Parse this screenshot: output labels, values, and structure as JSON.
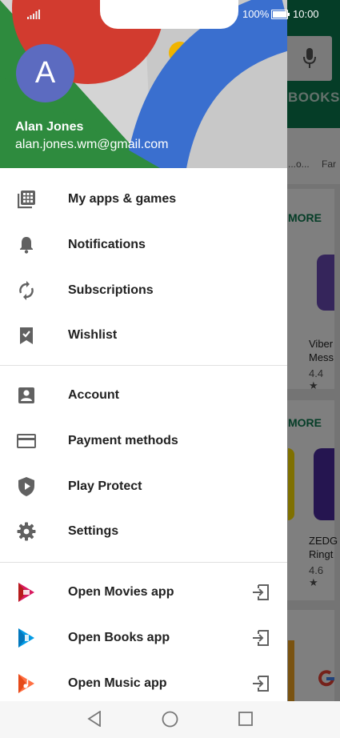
{
  "status_bar": {
    "battery": "100%",
    "time": "10:00"
  },
  "account": {
    "avatar_letter": "A",
    "name": "Alan Jones",
    "email": "alan.jones.wm@gmail.com"
  },
  "menu_groups": [
    [
      {
        "label": "My apps & games",
        "icon": "apps-grid-icon"
      },
      {
        "label": "Notifications",
        "icon": "bell-icon"
      },
      {
        "label": "Subscriptions",
        "icon": "refresh-icon"
      },
      {
        "label": "Wishlist",
        "icon": "bookmark-check-icon"
      }
    ],
    [
      {
        "label": "Account",
        "icon": "account-box-icon"
      },
      {
        "label": "Payment methods",
        "icon": "credit-card-icon"
      },
      {
        "label": "Play Protect",
        "icon": "shield-play-icon"
      },
      {
        "label": "Settings",
        "icon": "gear-icon"
      }
    ],
    [
      {
        "label": "Open Movies app",
        "icon": "play-movies-icon"
      },
      {
        "label": "Open Books app",
        "icon": "play-books-icon"
      },
      {
        "label": "Open Music app",
        "icon": "play-music-icon"
      }
    ]
  ],
  "background": {
    "tab": "BOOKS",
    "more_label": "MORE",
    "category_1": "...o...",
    "category_2": "Far",
    "app_1_name_line1": "Viber",
    "app_1_name_line2": "Mess",
    "app_1_rating": "4.4 ★",
    "app_2_name_line1": "ZEDG",
    "app_2_name_line2": "Ringt",
    "app_2_rating": "4.6 ★"
  },
  "colors": {
    "play_green": "#0b7a4f",
    "avatar": "#5c6bc0"
  }
}
